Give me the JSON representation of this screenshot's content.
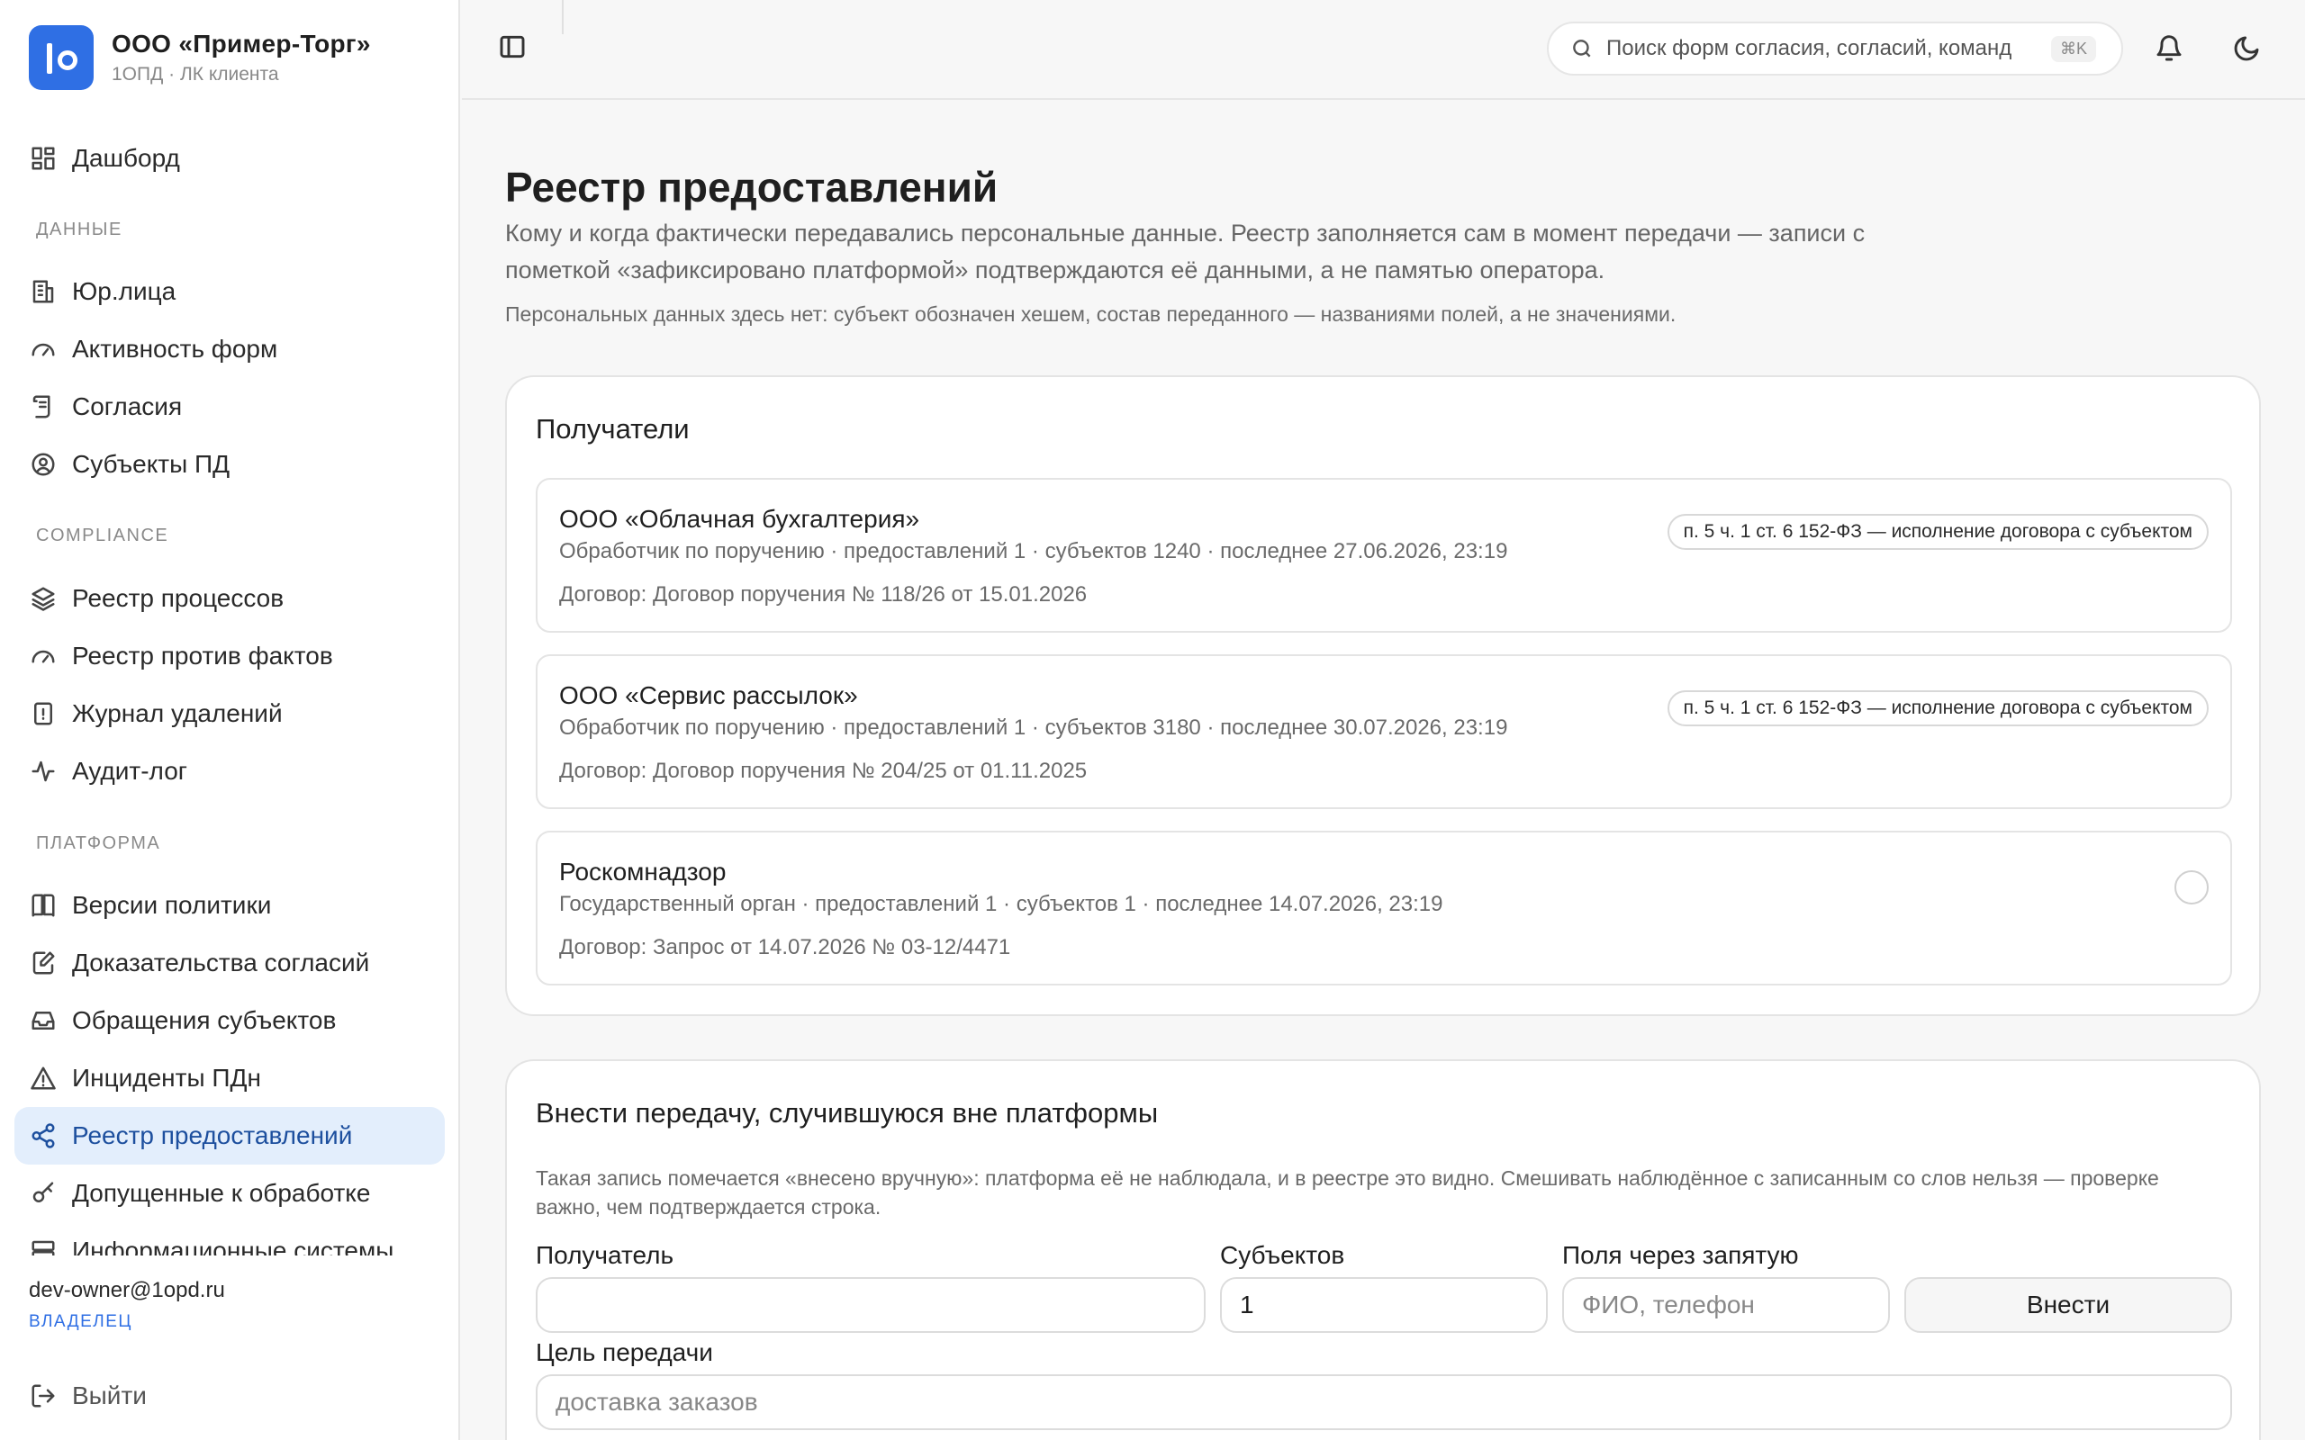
{
  "brand": {
    "name": "ООО «Пример-Торг»",
    "subtitle": "1ОПД · ЛК клиента"
  },
  "sidebar": {
    "items": [
      {
        "label": "Дашборд",
        "icon": "dashboard-icon"
      },
      {
        "section": "ДАННЫЕ"
      },
      {
        "label": "Юр.лица",
        "icon": "building-icon"
      },
      {
        "label": "Активность форм",
        "icon": "gauge-icon"
      },
      {
        "label": "Согласия",
        "icon": "scroll-icon"
      },
      {
        "label": "Субъекты ПД",
        "icon": "user-circle-icon"
      },
      {
        "section": "COMPLIANCE"
      },
      {
        "label": "Реестр процессов",
        "icon": "layers-icon"
      },
      {
        "label": "Реестр против фактов",
        "icon": "gauge-icon"
      },
      {
        "label": "Журнал удалений",
        "icon": "file-alert-icon"
      },
      {
        "label": "Аудит-лог",
        "icon": "activity-icon"
      },
      {
        "section": "ПЛАТФОРМА"
      },
      {
        "label": "Версии политики",
        "icon": "book-icon"
      },
      {
        "label": "Доказательства согласий",
        "icon": "file-edit-icon"
      },
      {
        "label": "Обращения субъектов",
        "icon": "inbox-icon"
      },
      {
        "label": "Инциденты ПДн",
        "icon": "warning-icon"
      },
      {
        "label": "Реестр предоставлений",
        "icon": "share-icon",
        "active": true
      },
      {
        "label": "Допущенные к обработке",
        "icon": "key-icon"
      },
      {
        "label": "Информационные системы",
        "icon": "server-icon"
      }
    ]
  },
  "user": {
    "email": "dev-owner@1opd.ru",
    "role": "ВЛАДЕЛЕЦ"
  },
  "logout_label": "Выйти",
  "search": {
    "placeholder": "Поиск форм согласия, согласий, команд",
    "shortcut": "⌘K"
  },
  "page": {
    "title": "Реестр предоставлений",
    "description": "Кому и когда фактически передавались персональные данные. Реестр заполняется сам в момент передачи — записи с пометкой «зафиксировано платформой» подтверждаются её данными, а не памятью оператора.",
    "note": "Персональных данных здесь нет: субъект обозначен хешем, состав переданного — названиями полей, а не значениями."
  },
  "recipients": {
    "title": "Получатели",
    "items": [
      {
        "name": "ООО «Облачная бухгалтерия»",
        "meta": "Обработчик по поручению · предоставлений 1 · субъектов 1240 · последнее 27.06.2026, 23:19",
        "contract": "Договор: Договор поручения № 118/26 от 15.01.2026",
        "basis": "п. 5 ч. 1 ст. 6 152-ФЗ — исполнение договора с субъектом"
      },
      {
        "name": "ООО «Сервис рассылок»",
        "meta": "Обработчик по поручению · предоставлений 1 · субъектов 3180 · последнее 30.07.2026, 23:19",
        "contract": "Договор: Договор поручения № 204/25 от 01.11.2025",
        "basis": "п. 5 ч. 1 ст. 6 152-ФЗ — исполнение договора с субъектом"
      },
      {
        "name": "Роскомнадзор",
        "meta": "Государственный орган · предоставлений 1 · субъектов 1 · последнее 14.07.2026, 23:19",
        "contract": "Договор: Запрос от 14.07.2026 № 03-12/4471",
        "basis": ""
      }
    ]
  },
  "manual_form": {
    "title": "Внести передачу, случившуюся вне платформы",
    "description": "Такая запись помечается «внесено вручную»: платформа её не наблюдала, и в реестре это видно. Смешивать наблюдённое с записанным со слов нельзя — проверке важно, чем подтверждается строка.",
    "recipient_label": "Получатель",
    "recipient_value": "",
    "subjects_label": "Субъектов",
    "subjects_value": "1",
    "fields_label": "Поля через запятую",
    "fields_placeholder": "ФИО, телефон",
    "submit_label": "Внести",
    "purpose_label": "Цель передачи",
    "purpose_placeholder": "доставка заказов"
  },
  "colors": {
    "accent": "#2f6fe4",
    "active_bg": "#e3eefc",
    "active_text": "#1d4f9e"
  }
}
